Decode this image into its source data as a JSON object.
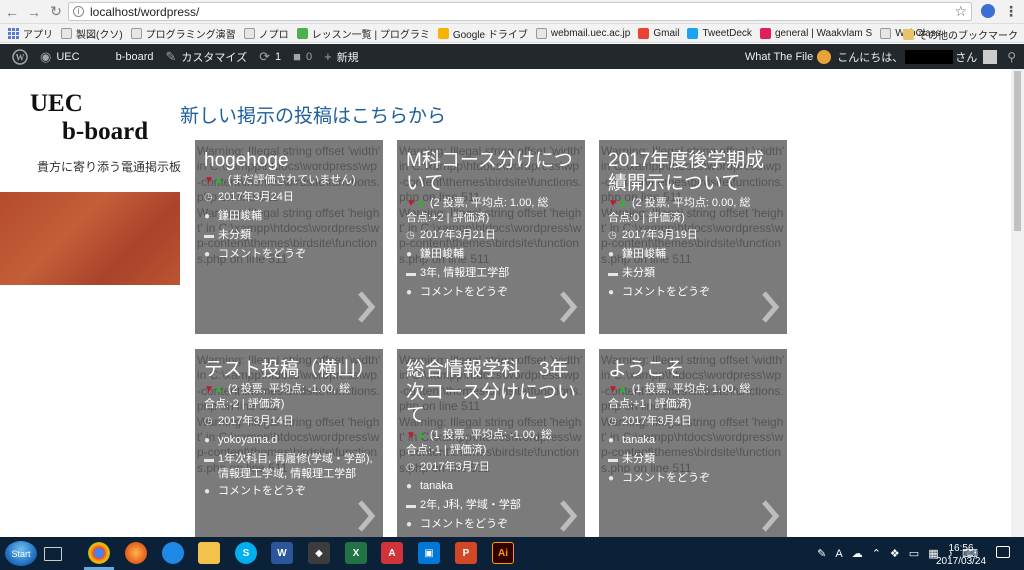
{
  "browser": {
    "url": "localhost/wordpress/",
    "bookmarks": [
      {
        "label": "アプリ",
        "color": "#5a7bd4"
      },
      {
        "label": "製図(クソ)",
        "color": "#e6e6e6"
      },
      {
        "label": "プログラミング演習",
        "color": "#e6e6e6"
      },
      {
        "label": "ノプロ",
        "color": "#e6e6e6"
      },
      {
        "label": "レッスン一覧 | プログラミ",
        "color": "#4caf50"
      },
      {
        "label": "Google ドライブ",
        "color": "#f4b400"
      },
      {
        "label": "webmail.uec.ac.jp",
        "color": "#e6e6e6"
      },
      {
        "label": "Gmail",
        "color": "#ea4335"
      },
      {
        "label": "TweetDeck",
        "color": "#1da1f2"
      },
      {
        "label": "general | Waakvlam S",
        "color": "#e01e5a"
      },
      {
        "label": "WebClass",
        "color": "#e6e6e6"
      }
    ],
    "more_label": "»",
    "other_bookmarks": "その他のブックマーク"
  },
  "adminbar": {
    "site": "UEC",
    "board": "b-board",
    "customize": "カスタマイズ",
    "updates": "1",
    "comments": "0",
    "new": "新規",
    "plugin": "What The File",
    "greeting": "こんにちは、",
    "greeting_suffix": "さん"
  },
  "site": {
    "title_line1": "UEC",
    "title_line2": "b-board",
    "tagline": "貴方に寄り添う電通掲示板",
    "heading": "新しい掲示の投稿はこちらから"
  },
  "cards": [
    {
      "bg": "Warning: Illegal string offset 'width' in C:\\xampp\\htdocs\\wordpress\\wp-content\\themes\\birdsite\\functions.php on line 511\nWarning: Illegal string offset 'height' in C:\\xampp\\htdocs\\wordpress\\wp-content\\themes\\birdsite\\functions.php on line 511",
      "title": "hogehoge",
      "rate_a": "(まだ評価されていません)",
      "rate_b": "",
      "date": "2017年3月24日",
      "author": "鎌田峻輔",
      "category": "未分類",
      "comment": "コメントをどうぞ"
    },
    {
      "bg": "Warning: Illegal string offset 'width' in C:\\xampp\\htdocs\\wordpress\\wp-content\\themes\\birdsite\\functions.php on line 511\nWarning: Illegal string offset 'height' in C:\\xampp\\htdocs\\wordpress\\wp-content\\themes\\birdsite\\functions.php on line 511",
      "title": "M科コース分けについて",
      "rate_a": "(2 投票, 平均点: 1.00, 総",
      "rate_b": "合点:+2 | 評価済)",
      "date": "2017年3月21日",
      "author": "鎌田峻輔",
      "category": "3年, 情報理工学部",
      "comment": "コメントをどうぞ"
    },
    {
      "bg": "Warning: Illegal string offset 'width' in C:\\xampp\\htdocs\\wordpress\\wp-content\\themes\\birdsite\\functions.php on line 511\nWarning: Illegal string offset 'height' in C:\\xampp\\htdocs\\wordpress\\wp-content\\themes\\birdsite\\functions.php on line 511",
      "title": "2017年度後学期成績開示について",
      "rate_a": "(2 投票, 平均点: 0.00, 総",
      "rate_b": "合点:0 | 評価済)",
      "date": "2017年3月19日",
      "author": "鎌田峻輔",
      "category": "未分類",
      "comment": "コメントをどうぞ"
    },
    {
      "bg": "Warning: Illegal string offset 'width' in C:\\xampp\\htdocs\\wordpress\\wp-content\\themes\\birdsite\\functions.php on line 511\nWarning: Illegal string offset 'height' in C:\\xampp\\htdocs\\wordpress\\wp-content\\themes\\birdsite\\functions.php on line 511",
      "title": "テスト投稿（横山）",
      "rate_a": "(2 投票, 平均点: -1.00, 総",
      "rate_b": "合点:-2 | 評価済)",
      "date": "2017年3月14日",
      "author": "yokoyama.d",
      "category": "1年次科目, 再履修(学域・学部), 情報理工学域, 情報理工学部",
      "comment": "コメントをどうぞ"
    },
    {
      "bg": "Warning: Illegal string offset 'width' in C:\\xampp\\htdocs\\wordpress\\wp-content\\themes\\birdsite\\functions.php on line 511\nWarning: Illegal string offset 'height' in C:\\xampp\\htdocs\\wordpress\\wp-content\\themes\\birdsite\\functions.php on line 511",
      "title": "総合情報学科　3年次コース分けについて",
      "rate_a": "(1 投票, 平均点: -1.00, 総",
      "rate_b": "合点:-1 | 評価済)",
      "date": "2017年3月7日",
      "author": "tanaka",
      "category": "2年, J科, 学域・学部",
      "comment": "コメントをどうぞ"
    },
    {
      "bg": "Warning: Illegal string offset 'width' in C:\\xampp\\htdocs\\wordpress\\wp-content\\themes\\birdsite\\functions.php on line 511\nWarning: Illegal string offset 'height' in C:\\xampp\\htdocs\\wordpress\\wp-content\\themes\\birdsite\\functions.php on line 511",
      "title": "ようこそ",
      "rate_a": "(1 投票, 平均点: 1.00, 総",
      "rate_b": "合点:+1 | 評価済)",
      "date": "2017年3月4日",
      "author": "tanaka",
      "category": "未分類",
      "comment": "コメントをどうぞ"
    }
  ],
  "taskbar": {
    "start": "Start",
    "time": "16:56",
    "date": "2017/03/24",
    "ime": "A"
  },
  "colors": {
    "card_bg": "#7b7b7b",
    "adminbar": "#23282d",
    "heading": "#1f5f9c",
    "taskbar": "#0b2138"
  }
}
